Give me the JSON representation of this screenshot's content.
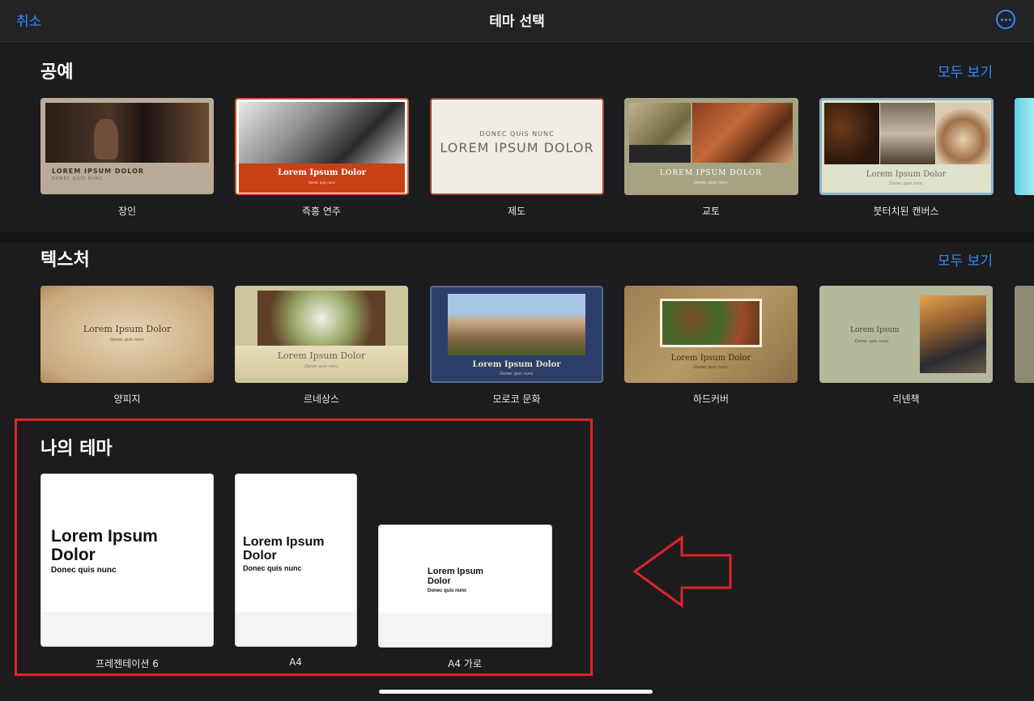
{
  "header": {
    "cancel": "취소",
    "title": "테마 선택",
    "more_icon": "ellipsis-circle-icon"
  },
  "sections": [
    {
      "title": "공예",
      "see_all": "모두 보기",
      "themes": [
        {
          "name": "장인",
          "title": "LOREM IPSUM DOLOR",
          "subtitle": "DONEC QUIS NUNC"
        },
        {
          "name": "즉흥 연주",
          "title": "Lorem Ipsum Dolor",
          "subtitle": "Donec quis nunc"
        },
        {
          "name": "제도",
          "title": "LOREM IPSUM DOLOR",
          "subtitle": "DONEC QUIS NUNC"
        },
        {
          "name": "교토",
          "title": "LOREM IPSUM DOLOR",
          "subtitle": "Donec quis nunc"
        },
        {
          "name": "붓터치된 캔버스",
          "title": "Lorem Ipsum Dolor",
          "subtitle": "Donec quis nunc"
        }
      ]
    },
    {
      "title": "텍스처",
      "see_all": "모두 보기",
      "themes": [
        {
          "name": "양피지",
          "title": "Lorem Ipsum Dolor",
          "subtitle": "Donec quis nunc"
        },
        {
          "name": "르네상스",
          "title": "Lorem Ipsum Dolor",
          "subtitle": "Donec quis nunc"
        },
        {
          "name": "모로코 문화",
          "title": "Lorem Ipsum Dolor",
          "subtitle": "Donec quis nunc"
        },
        {
          "name": "하드커버",
          "title": "Lorem Ipsum Dolor",
          "subtitle": "Donec quis nunc"
        },
        {
          "name": "리넨책",
          "title": "Lorem Ipsum",
          "subtitle": "Donec quis nunc"
        }
      ]
    },
    {
      "title": "나의 테마",
      "themes": [
        {
          "name": "프레젠테이션 6",
          "title_line1": "Lorem Ipsum",
          "title_line2": "Dolor",
          "subtitle": "Donec quis nunc"
        },
        {
          "name": "A4",
          "title_line1": "Lorem Ipsum",
          "title_line2": "Dolor",
          "subtitle": "Donec quis nunc"
        },
        {
          "name": "A4 가로",
          "title_line1": "Lorem Ipsum",
          "title_line2": "Dolor",
          "subtitle": "Donec quis nunc"
        }
      ]
    }
  ],
  "annotation": {
    "highlight_color": "#e0232a",
    "arrow_direction": "left"
  },
  "colors": {
    "accent": "#2f8cff",
    "background": "#1c1c1e"
  }
}
